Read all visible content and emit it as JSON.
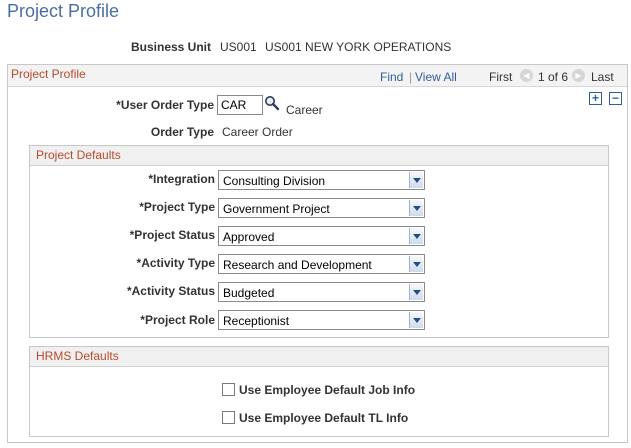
{
  "page": {
    "title": "Project Profile"
  },
  "business_unit": {
    "label": "Business Unit",
    "code": "US001",
    "description": "US001 NEW YORK OPERATIONS"
  },
  "profile": {
    "header_title": "Project Profile",
    "find_label": "Find",
    "separator": "|",
    "view_all_label": "View All",
    "first_label": "First",
    "counter": "1 of 6",
    "last_label": "Last",
    "add_symbol": "+",
    "remove_symbol": "−"
  },
  "user_order_type": {
    "label": "*User Order Type",
    "value": "CAR",
    "description": "Career"
  },
  "order_type": {
    "label": "Order Type",
    "value": "Career Order"
  },
  "project_defaults": {
    "title": "Project Defaults",
    "fields": [
      {
        "label": "*Integration",
        "value": "Consulting Division"
      },
      {
        "label": "*Project Type",
        "value": "Government Project"
      },
      {
        "label": "*Project Status",
        "value": "Approved"
      },
      {
        "label": "*Activity Type",
        "value": "Research and Development"
      },
      {
        "label": "*Activity Status",
        "value": "Budgeted"
      },
      {
        "label": "*Project Role",
        "value": "Receptionist"
      }
    ]
  },
  "hrms_defaults": {
    "title": "HRMS Defaults",
    "checkboxes": [
      {
        "label": "Use Employee Default Job Info",
        "checked": false
      },
      {
        "label": "Use Employee Default TL Info",
        "checked": false
      }
    ]
  },
  "icons": {
    "lookup": "magnifier-icon",
    "prev": "arrow-left-icon",
    "next": "arrow-right-icon",
    "dropdown": "chevron-down-icon"
  },
  "colors": {
    "title": "#4b6ea1",
    "section_header": "#b94a2c",
    "link": "#335ba3"
  }
}
